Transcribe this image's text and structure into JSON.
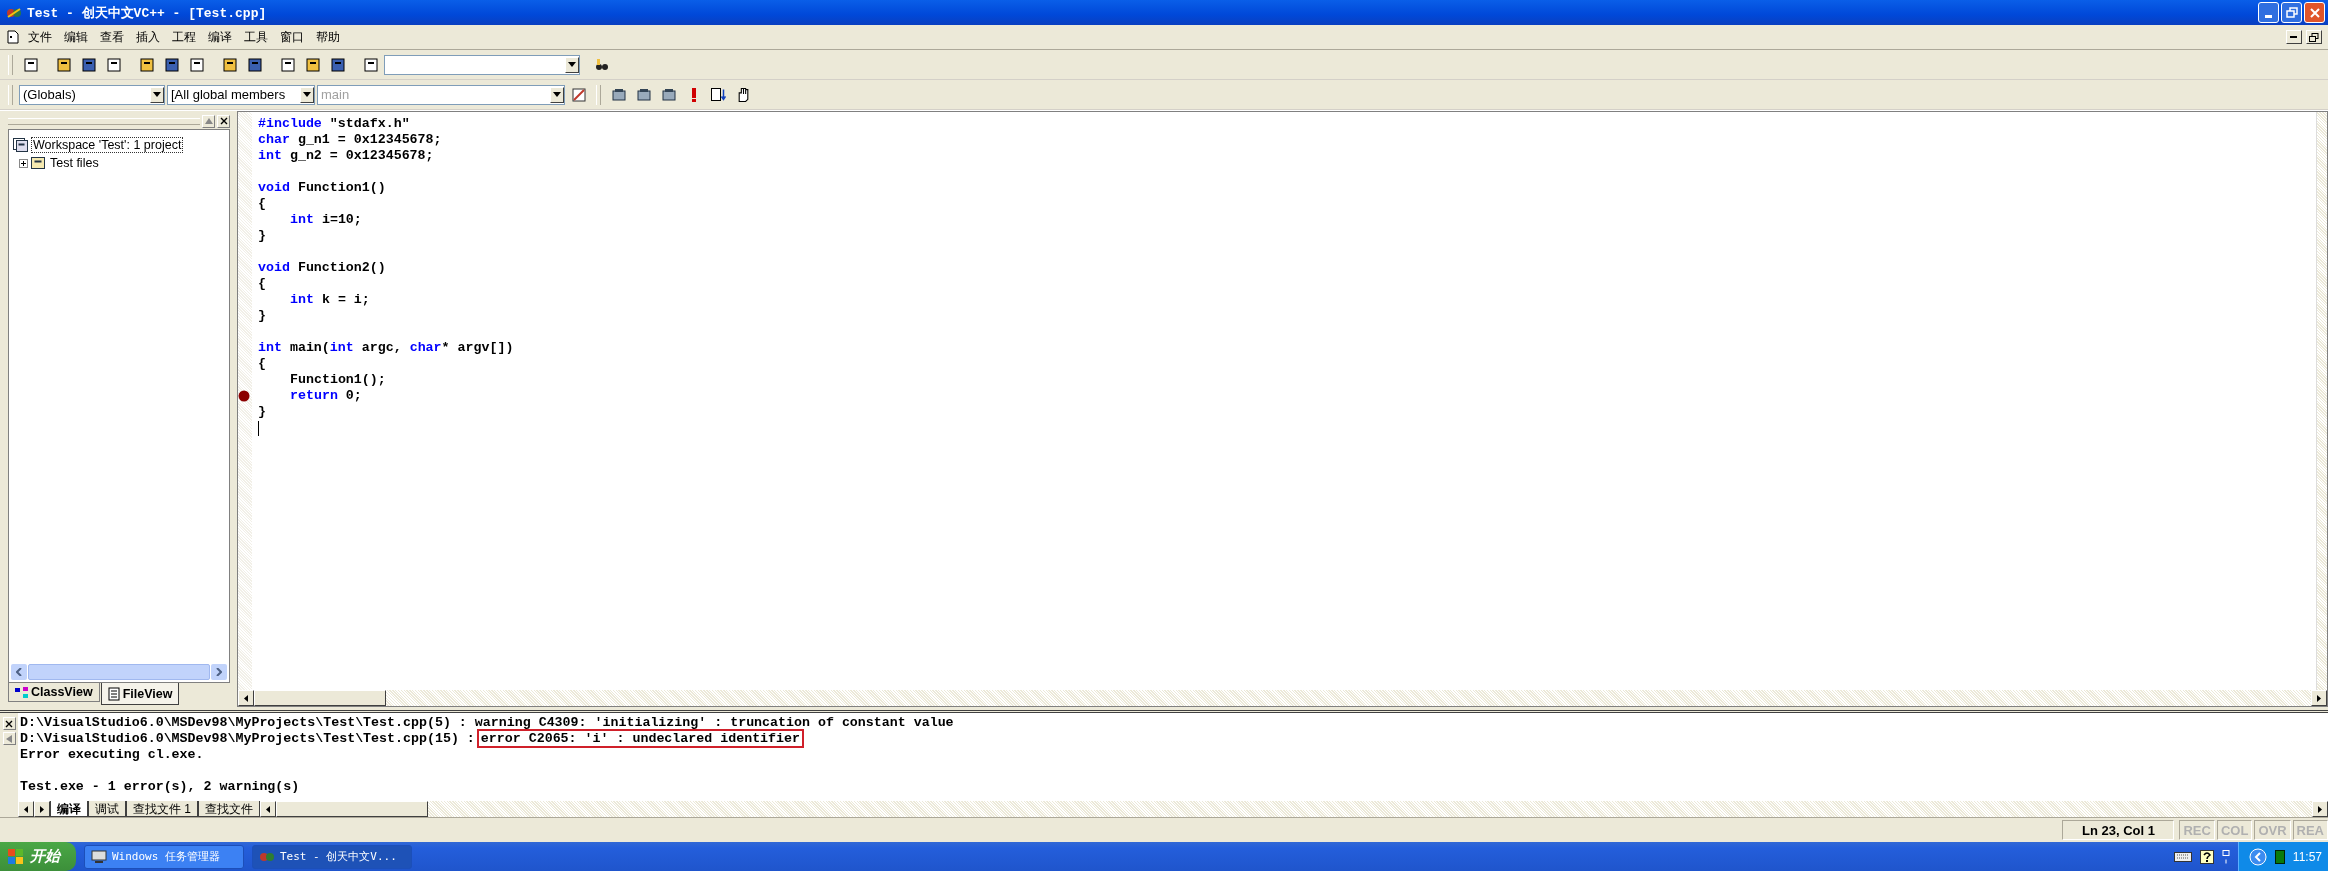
{
  "window": {
    "title": "Test - 创天中文VC++ - [Test.cpp]"
  },
  "menu": [
    "文件",
    "编辑",
    "查看",
    "插入",
    "工程",
    "编译",
    "工具",
    "窗口",
    "帮助"
  ],
  "combos": [
    {
      "value": "(Globals)",
      "disabled": false
    },
    {
      "value": "[All global members",
      "disabled": false
    },
    {
      "value": "main",
      "disabled": true
    }
  ],
  "workspace": {
    "tree": [
      {
        "label": "Workspace 'Test': 1 project",
        "selected": true,
        "children": [
          {
            "label": "Test files",
            "expanded": false
          }
        ]
      }
    ],
    "tabs": [
      {
        "label": "ClassView",
        "selected": false
      },
      {
        "label": "FileView",
        "selected": true
      }
    ]
  },
  "editor": {
    "lines": [
      {
        "breakpoint": false,
        "cursor": false,
        "indented": false,
        "tokens": [
          {
            "kind": "keyword",
            "text": "#include"
          },
          {
            "kind": "plain",
            "text": " \"stdafx.h\""
          }
        ]
      },
      {
        "breakpoint": false,
        "cursor": false,
        "indented": false,
        "tokens": [
          {
            "kind": "keyword",
            "text": "char"
          },
          {
            "kind": "plain",
            "text": " g_n1 = 0x12345678;"
          }
        ]
      },
      {
        "breakpoint": false,
        "cursor": false,
        "indented": false,
        "tokens": [
          {
            "kind": "keyword",
            "text": "int"
          },
          {
            "kind": "plain",
            "text": " g_n2 = 0x12345678;"
          }
        ]
      },
      {
        "breakpoint": false,
        "cursor": false
      },
      {
        "breakpoint": false,
        "cursor": false,
        "indented": false,
        "tokens": [
          {
            "kind": "keyword",
            "text": "void"
          },
          {
            "kind": "plain",
            "text": " Function1()"
          }
        ]
      },
      {
        "breakpoint": false,
        "cursor": false,
        "indented": false,
        "tokens": [
          {
            "kind": "plain",
            "text": "{"
          }
        ]
      },
      {
        "breakpoint": false,
        "cursor": false,
        "indented": true,
        "tokens": [
          {
            "kind": "keyword",
            "text": "int"
          },
          {
            "kind": "plain",
            "text": " i=10;"
          }
        ]
      },
      {
        "breakpoint": false,
        "cursor": false,
        "indented": false,
        "tokens": [
          {
            "kind": "plain",
            "text": "}"
          }
        ]
      },
      {
        "breakpoint": false,
        "cursor": false
      },
      {
        "breakpoint": false,
        "cursor": false,
        "indented": false,
        "tokens": [
          {
            "kind": "keyword",
            "text": "void"
          },
          {
            "kind": "plain",
            "text": " Function2()"
          }
        ]
      },
      {
        "breakpoint": false,
        "cursor": false,
        "indented": false,
        "tokens": [
          {
            "kind": "plain",
            "text": "{"
          }
        ]
      },
      {
        "breakpoint": false,
        "cursor": false,
        "indented": true,
        "tokens": [
          {
            "kind": "keyword",
            "text": "int"
          },
          {
            "kind": "plain",
            "text": " k = i;"
          }
        ]
      },
      {
        "breakpoint": false,
        "cursor": false,
        "indented": false,
        "tokens": [
          {
            "kind": "plain",
            "text": "}"
          }
        ]
      },
      {
        "breakpoint": false,
        "cursor": false
      },
      {
        "breakpoint": false,
        "cursor": false,
        "indented": false,
        "tokens": [
          {
            "kind": "keyword",
            "text": "int"
          },
          {
            "kind": "plain",
            "text": " main("
          },
          {
            "kind": "keyword",
            "text": "int"
          },
          {
            "kind": "plain",
            "text": " argc, "
          },
          {
            "kind": "keyword",
            "text": "char"
          },
          {
            "kind": "plain",
            "text": "* argv[])"
          }
        ]
      },
      {
        "breakpoint": false,
        "cursor": false,
        "indented": false,
        "tokens": [
          {
            "kind": "plain",
            "text": "{"
          }
        ]
      },
      {
        "breakpoint": false,
        "cursor": false,
        "indented": true,
        "tokens": [
          {
            "kind": "plain",
            "text": "Function1();"
          }
        ]
      },
      {
        "breakpoint": true,
        "cursor": false,
        "indented": true,
        "tokens": [
          {
            "kind": "keyword",
            "text": "return"
          },
          {
            "kind": "plain",
            "text": " 0;"
          }
        ]
      },
      {
        "breakpoint": false,
        "cursor": false,
        "indented": false,
        "tokens": [
          {
            "kind": "plain",
            "text": "}"
          }
        ]
      },
      {
        "breakpoint": false,
        "cursor": true
      }
    ]
  },
  "output": {
    "groups": [
      {
        "lines": [
          {
            "segments": [
              {
                "text": "D:\\VisualStudio6.0\\MSDev98\\MyProjects\\Test\\Test.cpp(5) : warning C4309: 'initializing' : truncation of constant value",
                "highlighted": false
              }
            ]
          },
          {
            "segments": [
              {
                "text": "D:\\VisualStudio6.0\\MSDev98\\MyProjects\\Test\\Test.cpp(15) :",
                "highlighted": false
              },
              {
                "text": "error C2065: 'i' : undeclared identifier",
                "highlighted": true
              }
            ]
          },
          {
            "segments": [
              {
                "text": "Error executing cl.exe.",
                "highlighted": false
              }
            ]
          }
        ]
      },
      {
        "lines": [
          {
            "segments": [
              {
                "text": "Test.exe - 1 error(s), 2 warning(s)",
                "highlighted": false
              }
            ]
          }
        ]
      }
    ],
    "tabs": [
      {
        "label": "编译",
        "selected": true
      },
      {
        "label": "调试",
        "selected": false
      },
      {
        "label": "查找文件 1",
        "selected": false
      },
      {
        "label": "查找文件",
        "selected": false
      }
    ]
  },
  "status": {
    "position": "Ln 23, Col 1",
    "indicators": [
      {
        "label": "REC",
        "on": false
      },
      {
        "label": "COL",
        "on": false
      },
      {
        "label": "OVR",
        "on": false
      },
      {
        "label": "REA",
        "on": false
      }
    ]
  },
  "taskbar": {
    "start": "开始",
    "tasks": [
      {
        "label": "Windows 任务管理器",
        "selected": false
      },
      {
        "label": "Test - 创天中文V...",
        "selected": true
      }
    ],
    "clock": "11:57"
  }
}
